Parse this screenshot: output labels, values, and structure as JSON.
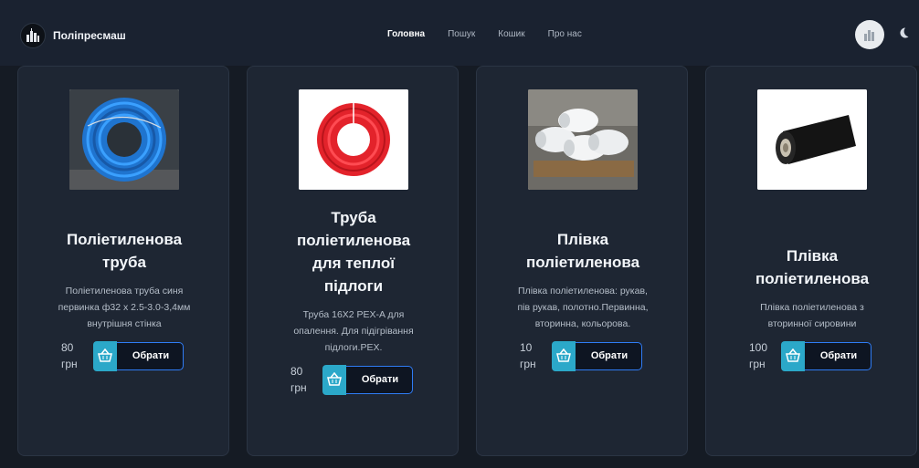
{
  "header": {
    "brand": "Поліпресмаш",
    "nav": [
      "Головна",
      "Пошук",
      "Кошик",
      "Про нас"
    ]
  },
  "products": [
    {
      "title": "Поліетиленова труба",
      "description": "Поліетиленова труба синя первинка ф32 х 2.5-3.0-3,4мм внутрішня стінка",
      "price_value": "80",
      "price_unit": "грн",
      "button": "Обрати",
      "image": "blue-pipe-coil"
    },
    {
      "title": "Труба поліетиленова для теплої підлоги",
      "description": "Труба 16X2 PEX-A для опалення. Для підігрівання підлоги.PEX.",
      "price_value": "80",
      "price_unit": "грн",
      "button": "Обрати",
      "image": "red-pipe-coil"
    },
    {
      "title": "Плівка поліетиленова",
      "description": "Плівка поліетиленова: рукав, пів рукав, полотно.Первинна, вторинна, кольорова.",
      "price_value": "10",
      "price_unit": "грн",
      "button": "Обрати",
      "image": "white-film-rolls"
    },
    {
      "title": "Плівка поліетиленова",
      "description": "Плівка поліетиленова з вторинної сировини",
      "price_value": "100",
      "price_unit": "грн",
      "button": "Обрати",
      "image": "black-film-roll"
    }
  ]
}
